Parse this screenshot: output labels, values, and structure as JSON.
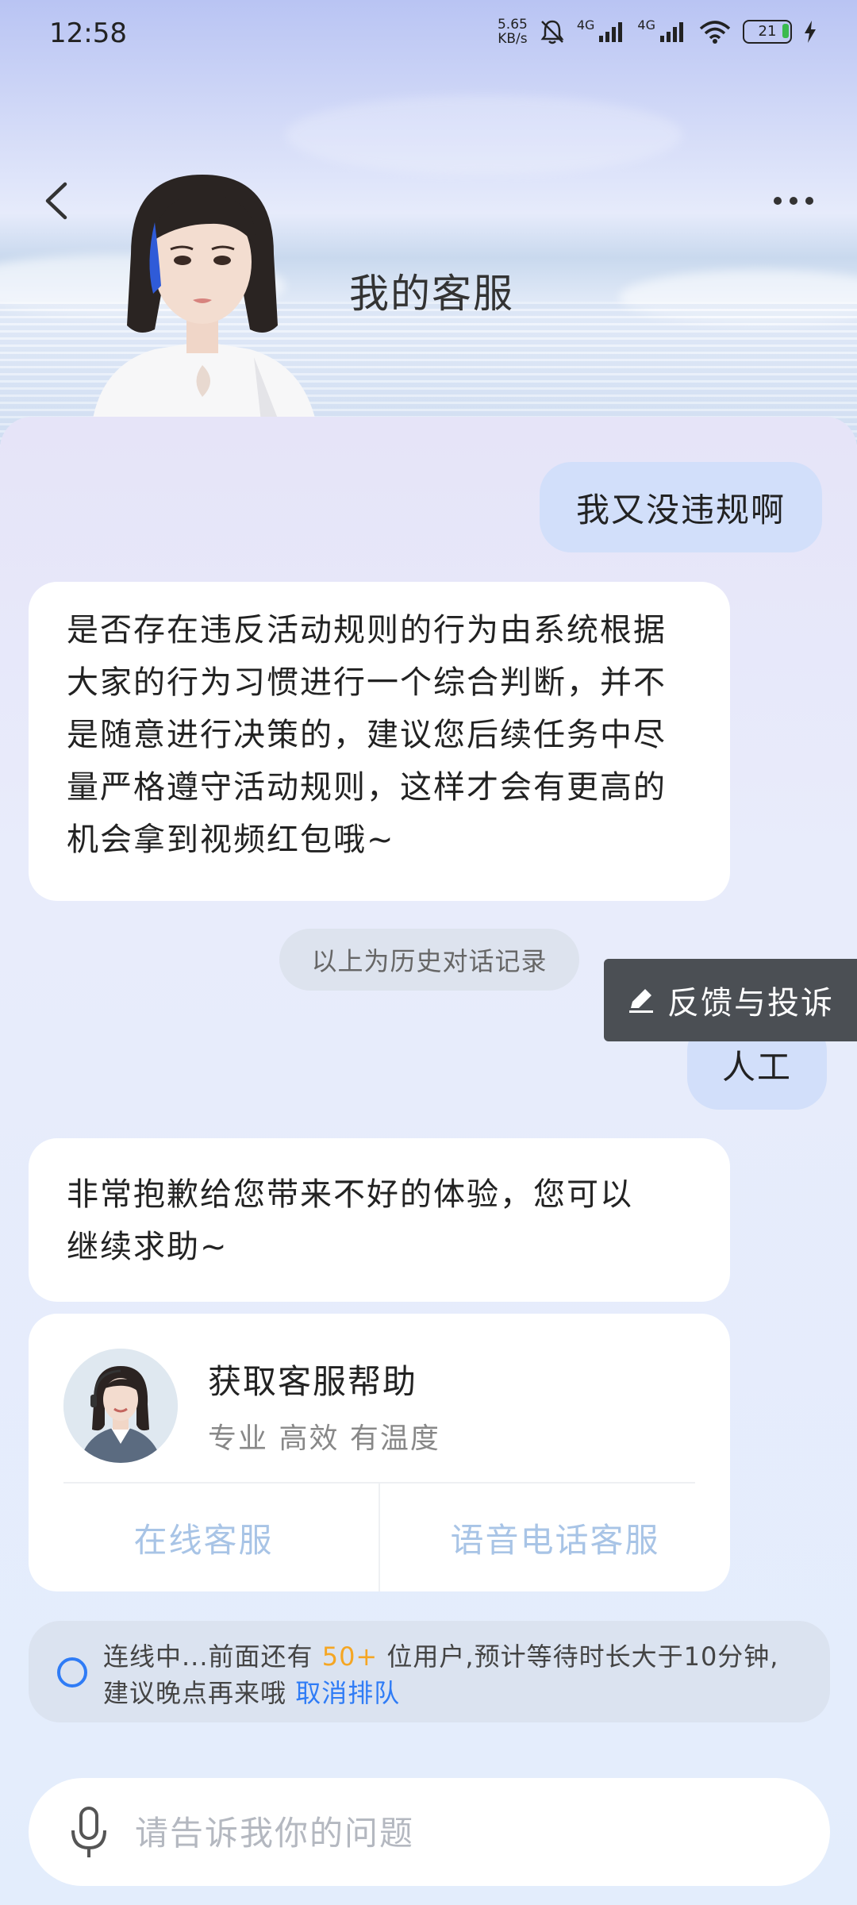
{
  "status_bar": {
    "time": "12:58",
    "net_speed_value": "5.65",
    "net_speed_unit": "KB/s",
    "network_1": "4G",
    "network_2": "4G",
    "battery": "21"
  },
  "header": {
    "title": "我的客服"
  },
  "messages": {
    "user_1": "我又没违规啊",
    "bot_1_lines": [
      "是否存在违反活动规则的行为由系统根据",
      "大家的行为习惯进行一个综合判断，并不",
      "是随意进行决策的，建议您后续任务中尽",
      "量严格遵守活动规则，这样才会有更高的",
      "机会拿到视频红包哦~"
    ],
    "history_divider": "以上为历史对话记录",
    "user_2": "人工",
    "bot_2_lines": [
      "非常抱歉给您带来不好的体验，您可以",
      "继续求助~"
    ]
  },
  "feedback": {
    "label": "反馈与投诉"
  },
  "service_card": {
    "title": "获取客服帮助",
    "subtitle": "专业 高效 有温度",
    "online_label": "在线客服",
    "voice_label": "语音电话客服"
  },
  "queue": {
    "prefix": "连线中...前面还有 ",
    "count": "50+",
    "middle": " 位用户,预计等待时长大于10分钟,建议晚点再来哦 ",
    "cancel": "取消排队"
  },
  "input": {
    "placeholder": "请告诉我你的问题"
  },
  "colors": {
    "accent_blue": "#2f7cf6",
    "queue_count_orange": "#f5a623",
    "user_bubble": "#d2dffa"
  }
}
